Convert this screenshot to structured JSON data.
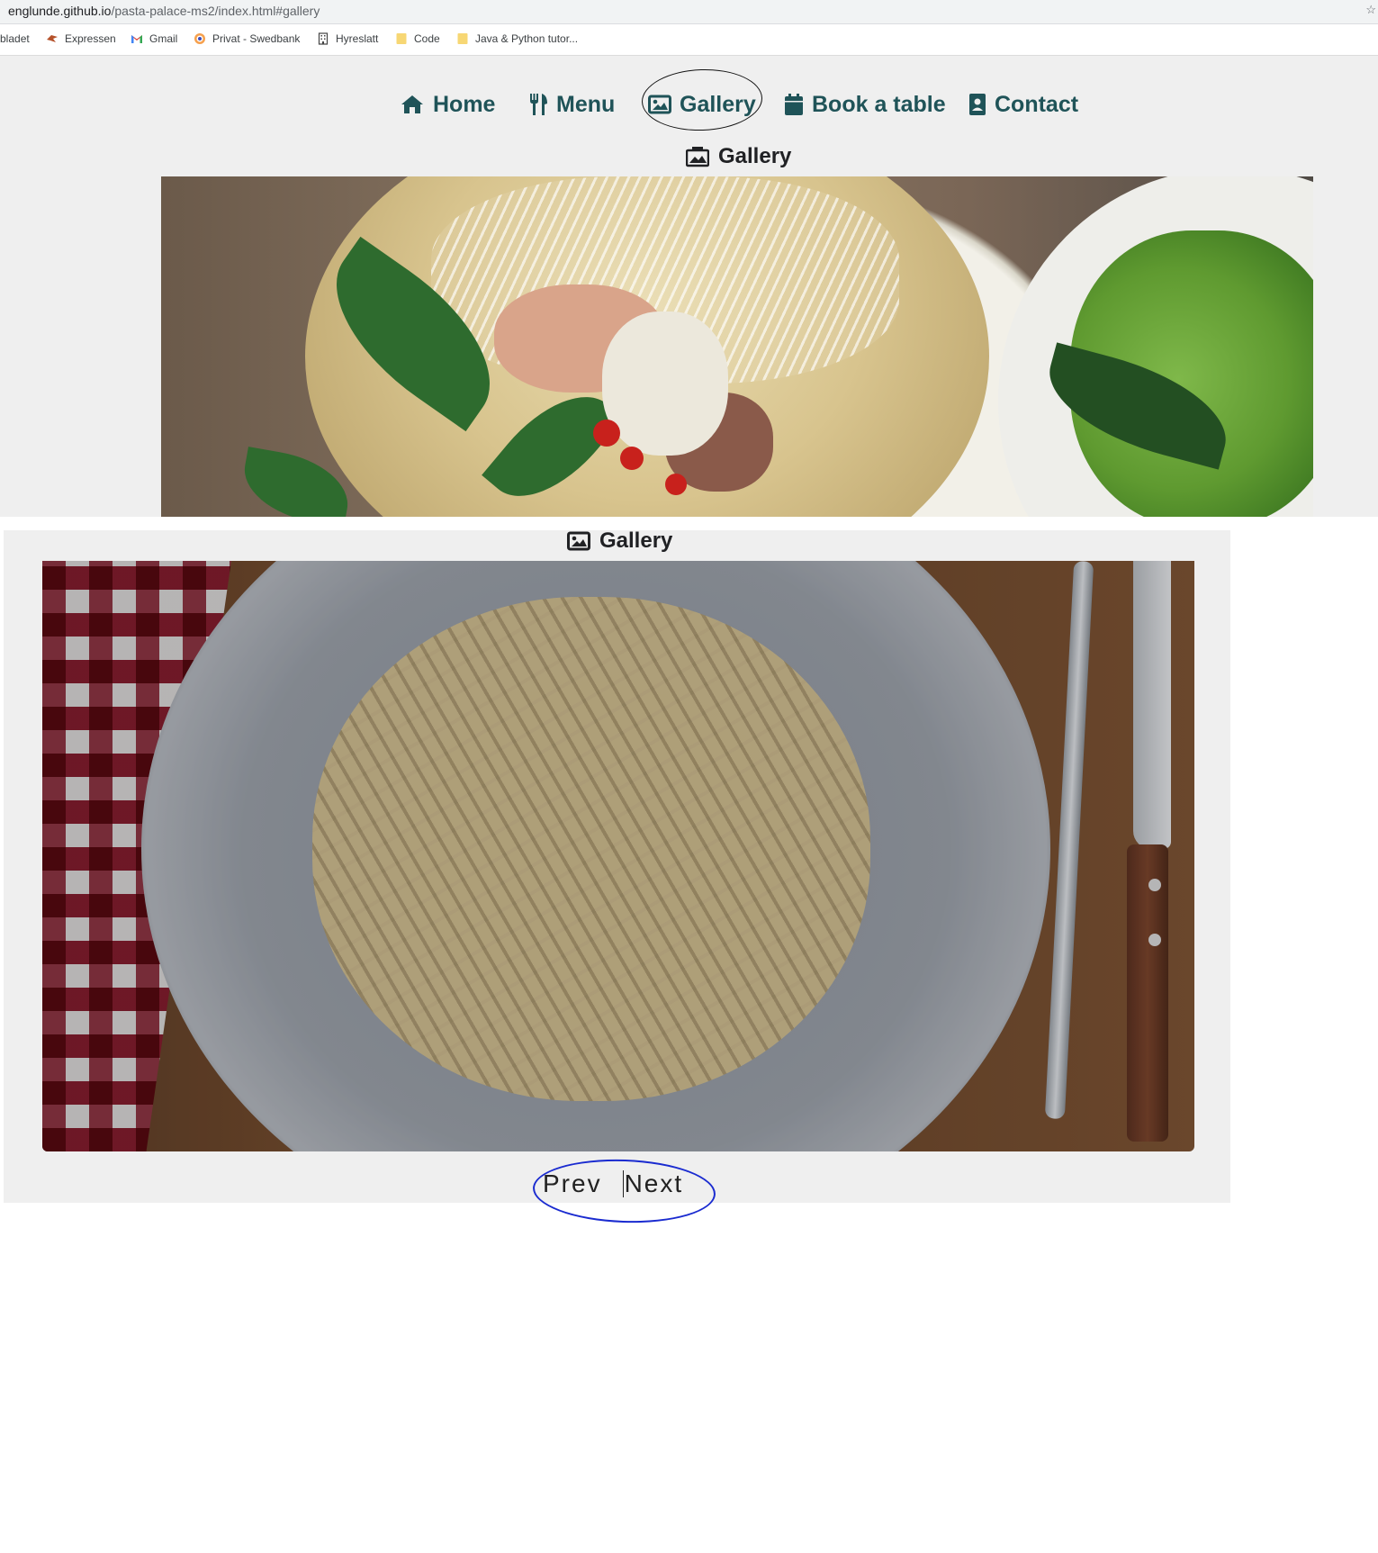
{
  "browser": {
    "url_host": "englunde.github.io",
    "url_path": "/pasta-palace-ms2/index.html#gallery",
    "bookmarks": [
      {
        "label": "bladet",
        "icon": "none"
      },
      {
        "label": "Expressen",
        "icon": "expressen-icon"
      },
      {
        "label": "Gmail",
        "icon": "gmail-icon"
      },
      {
        "label": "Privat - Swedbank",
        "icon": "swedbank-icon"
      },
      {
        "label": "Hyreslatt",
        "icon": "building-icon"
      },
      {
        "label": "Code",
        "icon": "folder-icon"
      },
      {
        "label": "Java & Python tutor...",
        "icon": "folder-icon"
      }
    ]
  },
  "nav": {
    "home": "Home",
    "menu": "Menu",
    "gallery": "Gallery",
    "book": "Book a table",
    "contact": "Contact",
    "color": "#1f5358"
  },
  "section_top": {
    "title": "Gallery",
    "icon": "photo-video-icon"
  },
  "images": {
    "top": "Soup bowl with noodles, herbs, meat and chili next to a salad plate",
    "bottom": "Plate of penne pasta with cream sauce, red-checked napkin, fork and knife"
  },
  "section_bottom": {
    "title": "Gallery",
    "icon": "image-icon"
  },
  "pager": {
    "prev": "Prev",
    "next": "Next"
  },
  "annotations": {
    "gallery_circle_color": "#111111",
    "pager_circle_color": "#1a2bd0"
  }
}
